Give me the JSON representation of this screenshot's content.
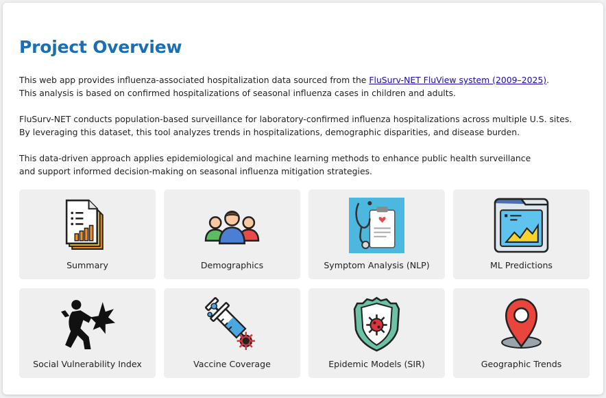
{
  "overview": {
    "title": "Project Overview",
    "p1_before_link": "This web app provides influenza-associated hospitalization data sourced from the ",
    "p1_link": "FluSurv-NET FluView system (2009–2025)",
    "p1_after_link": ".",
    "p1_line2": "This analysis is based on confirmed hospitalizations of seasonal influenza cases in children and adults.",
    "p2_line1": "FluSurv-NET conducts population-based surveillance for laboratory-confirmed influenza hospitalizations across multiple U.S. sites.",
    "p2_line2": "By leveraging this dataset, this tool analyzes trends in hospitalizations, demographic disparities, and disease burden.",
    "p3_line1": "This data-driven approach applies epidemiological and machine learning methods to enhance public health surveillance",
    "p3_line2": "and support informed decision-making on seasonal influenza mitigation strategies."
  },
  "tiles": [
    {
      "label": "Summary",
      "icon": "report-document-icon"
    },
    {
      "label": "Demographics",
      "icon": "people-group-icon"
    },
    {
      "label": "Symptom Analysis (NLP)",
      "icon": "stethoscope-clipboard-icon"
    },
    {
      "label": "ML Predictions",
      "icon": "chart-window-icon"
    },
    {
      "label": "Social Vulnerability Index",
      "icon": "person-falling-icon"
    },
    {
      "label": "Vaccine Coverage",
      "icon": "vaccine-syringe-icon"
    },
    {
      "label": "Epidemic Models (SIR)",
      "icon": "virus-shield-icon"
    },
    {
      "label": "Geographic Trends",
      "icon": "map-pin-icon"
    }
  ],
  "colors": {
    "title": "#1a6fb3",
    "link": "#1a0dab",
    "tile_bg": "#efefef",
    "page_bg": "#ffffff"
  }
}
